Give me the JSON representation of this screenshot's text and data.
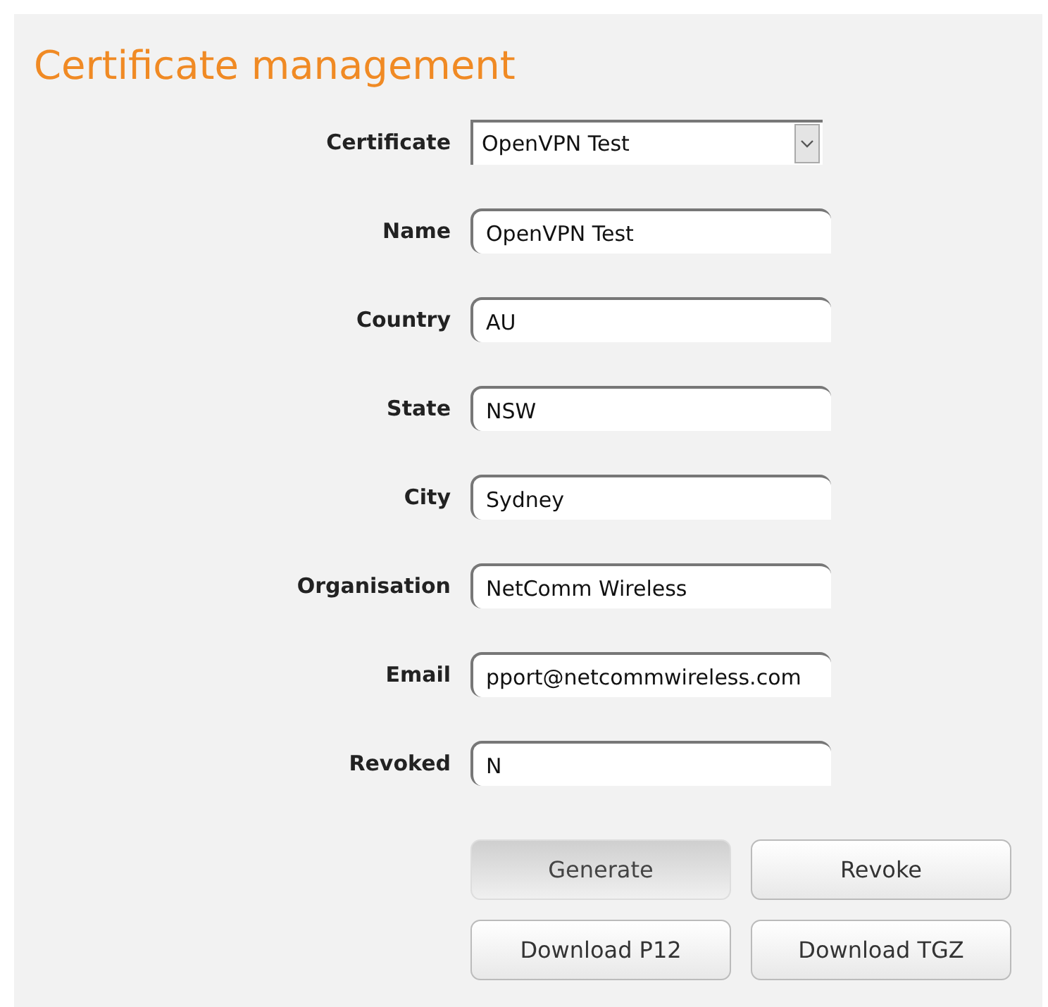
{
  "title": "Certificate management",
  "fields": [
    {
      "label": "Certificate",
      "kind": "select",
      "value": "OpenVPN Test"
    },
    {
      "label": "Name",
      "kind": "text",
      "value": "OpenVPN Test"
    },
    {
      "label": "Country",
      "kind": "text",
      "value": "AU"
    },
    {
      "label": "State",
      "kind": "text",
      "value": "NSW"
    },
    {
      "label": "City",
      "kind": "text",
      "value": "Sydney"
    },
    {
      "label": "Organisation",
      "kind": "text",
      "value": "NetComm Wireless"
    },
    {
      "label": "Email",
      "kind": "text",
      "value": "pport@netcommwireless.com"
    },
    {
      "label": "Revoked",
      "kind": "text",
      "value": "N"
    }
  ],
  "buttons": [
    {
      "label": "Generate",
      "pressed": true
    },
    {
      "label": "Revoke",
      "pressed": false
    },
    {
      "label": "Download P12",
      "pressed": false
    },
    {
      "label": "Download TGZ",
      "pressed": false
    }
  ]
}
